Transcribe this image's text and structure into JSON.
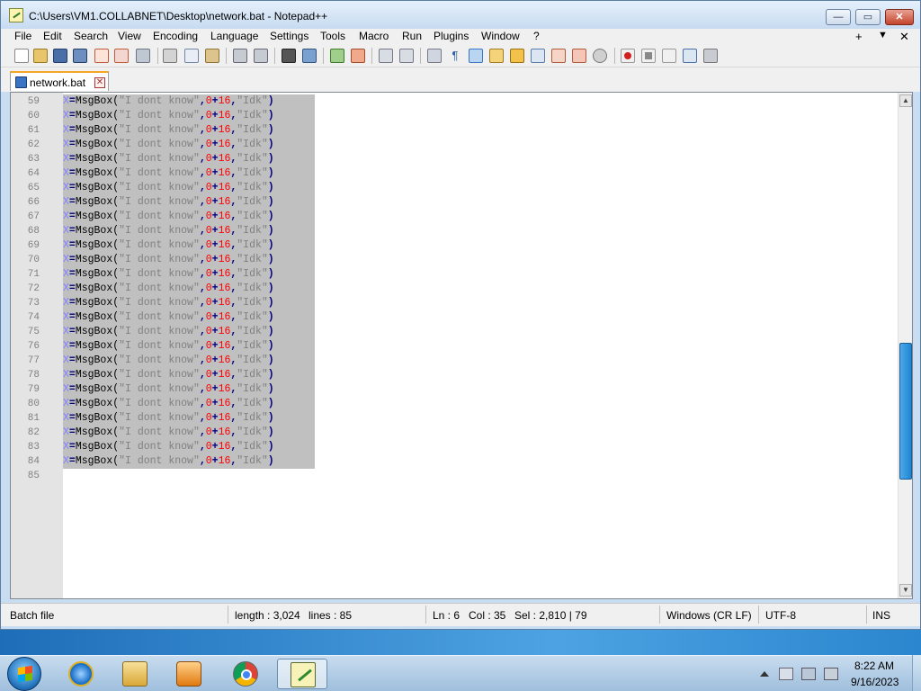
{
  "window": {
    "title": "C:\\Users\\VM1.COLLABNET\\Desktop\\network.bat - Notepad++",
    "buttons": {
      "minimize": "—",
      "maximize": "▭",
      "close": "✕"
    }
  },
  "menubar": {
    "items": [
      "File",
      "Edit",
      "Search",
      "View",
      "Encoding",
      "Language",
      "Settings",
      "Tools",
      "Macro",
      "Run",
      "Plugins",
      "Window",
      "?"
    ],
    "right": {
      "plus": "+",
      "dropdown": "▼",
      "close": "✕"
    }
  },
  "tab": {
    "label": "network.bat",
    "close": "✕"
  },
  "editor": {
    "line_numbers": [
      "59",
      "60",
      "61",
      "62",
      "63",
      "64",
      "65",
      "66",
      "67",
      "68",
      "69",
      "70",
      "71",
      "72",
      "73",
      "74",
      "75",
      "76",
      "77",
      "78",
      "79",
      "80",
      "81",
      "82",
      "83",
      "84",
      "85"
    ],
    "code": {
      "var": "X",
      "eq": "=",
      "func": "MsgBox(",
      "str1": "\"I dont know\"",
      "comma1": ",",
      "n0": "0",
      "plus": "+",
      "n16": "16",
      "comma2": ",",
      "str2": "\"Idk\"",
      "close": ")"
    },
    "selected_lines": 26,
    "scroll_fraction": 0.62
  },
  "statusbar": {
    "filetype": "Batch file",
    "length": "length : 3,024",
    "lines": "lines : 85",
    "ln": "Ln : 6",
    "col": "Col : 35",
    "sel": "Sel : 2,810 | 79",
    "eol": "Windows (CR LF)",
    "encoding": "UTF-8",
    "mode": "INS"
  },
  "taskbar": {
    "apps": [
      "internet-explorer",
      "file-explorer",
      "media-player",
      "chrome",
      "notepad-plus-plus"
    ],
    "active_app": "notepad-plus-plus",
    "clock_time": "8:22 AM",
    "clock_date": "9/16/2023"
  },
  "colors": {
    "selection": "#c0c0c0",
    "accent_tab": "#f5a623",
    "scroll_thumb": "#1f86d4"
  }
}
